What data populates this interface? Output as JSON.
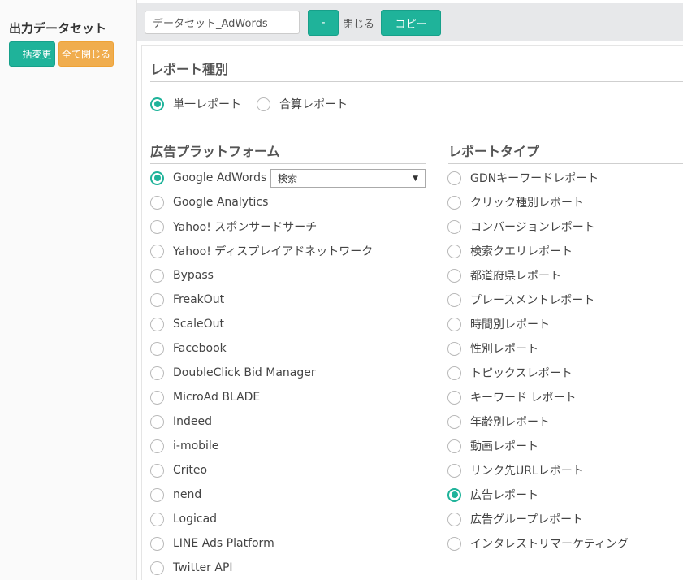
{
  "sidebar": {
    "title": "出力データセット",
    "bulk_change_label": "一括変更",
    "close_all_label": "全て閉じる"
  },
  "toolbar": {
    "dataset_name_value": "データセット_AdWords",
    "collapse_label": "-",
    "close_label": "閉じる",
    "copy_label": "コピー"
  },
  "report_kind": {
    "heading": "レポート種別",
    "options": [
      {
        "label": "単一レポート",
        "checked": true
      },
      {
        "label": "合算レポート",
        "checked": false
      }
    ]
  },
  "platforms": {
    "heading": "広告プラットフォーム",
    "dropdown_value": "検索",
    "items": [
      {
        "label": "Google AdWords",
        "checked": true
      },
      {
        "label": "Google Analytics",
        "checked": false
      },
      {
        "label": "Yahoo! スポンサードサーチ",
        "checked": false
      },
      {
        "label": "Yahoo! ディスプレイアドネットワーク",
        "checked": false
      },
      {
        "label": "Bypass",
        "checked": false
      },
      {
        "label": "FreakOut",
        "checked": false
      },
      {
        "label": "ScaleOut",
        "checked": false
      },
      {
        "label": "Facebook",
        "checked": false
      },
      {
        "label": "DoubleClick Bid Manager",
        "checked": false
      },
      {
        "label": "MicroAd BLADE",
        "checked": false
      },
      {
        "label": "Indeed",
        "checked": false
      },
      {
        "label": "i-mobile",
        "checked": false
      },
      {
        "label": "Criteo",
        "checked": false
      },
      {
        "label": "nend",
        "checked": false
      },
      {
        "label": "Logicad",
        "checked": false
      },
      {
        "label": "LINE Ads Platform",
        "checked": false
      },
      {
        "label": "Twitter API",
        "checked": false
      }
    ]
  },
  "report_types": {
    "heading": "レポートタイプ",
    "items": [
      {
        "label": "GDNキーワードレポート",
        "checked": false
      },
      {
        "label": "クリック種別レポート",
        "checked": false
      },
      {
        "label": "コンバージョンレポート",
        "checked": false
      },
      {
        "label": "検索クエリレポート",
        "checked": false
      },
      {
        "label": "都道府県レポート",
        "checked": false
      },
      {
        "label": "プレースメントレポート",
        "checked": false
      },
      {
        "label": "時間別レポート",
        "checked": false
      },
      {
        "label": "性別レポート",
        "checked": false
      },
      {
        "label": "トピックスレポート",
        "checked": false
      },
      {
        "label": "キーワード レポート",
        "checked": false
      },
      {
        "label": "年齢別レポート",
        "checked": false
      },
      {
        "label": "動画レポート",
        "checked": false
      },
      {
        "label": "リンク先URLレポート",
        "checked": false
      },
      {
        "label": "広告レポート",
        "checked": true
      },
      {
        "label": "広告グループレポート",
        "checked": false
      },
      {
        "label": "インタレストリマーケティング",
        "checked": false
      }
    ]
  },
  "colors": {
    "accent": "#1fb39a",
    "orange": "#f0ad4e",
    "toolbar_bg": "#e7e8ea"
  }
}
